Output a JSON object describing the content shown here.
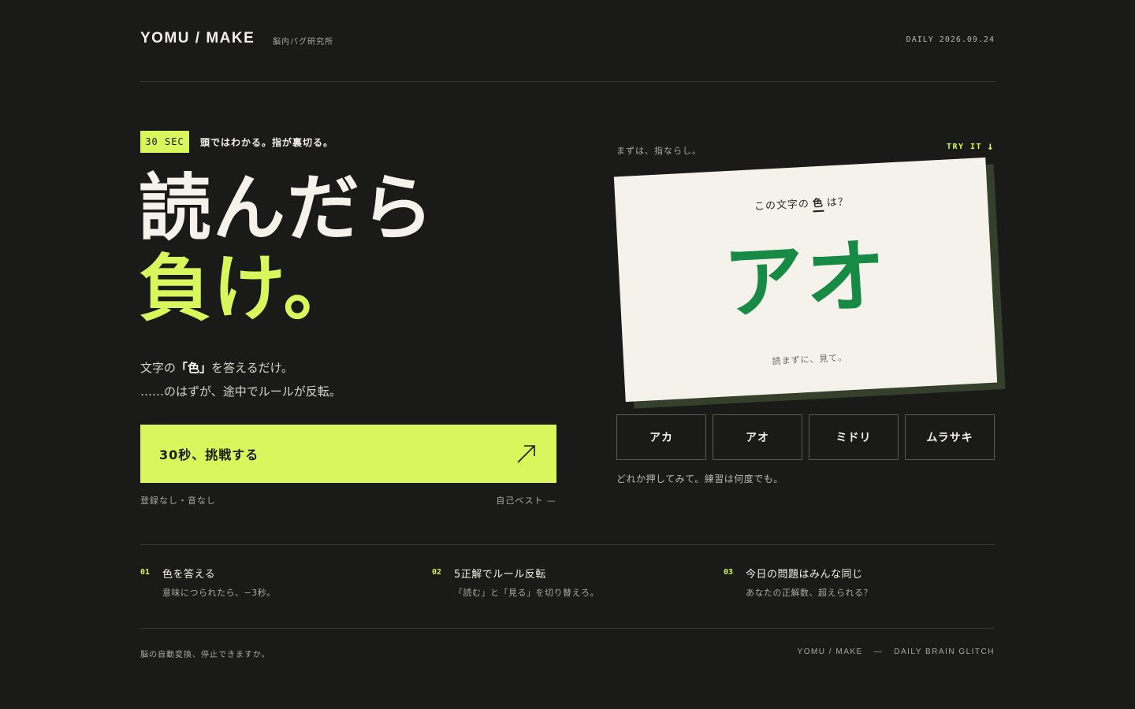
{
  "header": {
    "brand": "YOMU / MAKE",
    "brand_sub": "脳内バグ研究所",
    "daily": "DAILY 2026.09.24"
  },
  "hero": {
    "badge": "30 SEC",
    "tagline": "頭ではわかる。指が裏切る。",
    "headline_line1": "読んだら",
    "headline_line2": "負け。",
    "desc_part1": "文字の",
    "desc_bold": "「色」",
    "desc_part2": "を答えるだけ。",
    "desc_line2": "……のはずが、途中でルールが反転。",
    "cta_label": "30秒、挑戦する",
    "sub_left": "登録なし・音なし",
    "sub_right": "自己ベスト —"
  },
  "demo": {
    "hint": "まずは、指ならし。",
    "try_it": "TRY IT",
    "card": {
      "question_pre": "この文字の",
      "question_em": "色",
      "question_post": "は？",
      "word": "アオ",
      "word_color": "#178a45",
      "footer": "読まずに、見て。"
    },
    "answers": [
      "アカ",
      "アオ",
      "ミドリ",
      "ムラサキ"
    ],
    "note": "どれか押してみて。練習は何度でも。"
  },
  "steps": [
    {
      "num": "01",
      "title": "色を答える",
      "desc": "意味につられたら、−3秒。"
    },
    {
      "num": "02",
      "title": "5正解でルール反転",
      "desc": "「読む」と「見る」を切り替えろ。"
    },
    {
      "num": "03",
      "title": "今日の問題はみんな同じ",
      "desc": "あなたの正解数、超えられる？"
    }
  ],
  "footer": {
    "left": "脳の自動変換、停止できますか。",
    "right_brand": "YOMU / MAKE",
    "right_sep": "—",
    "right_tag": "DAILY BRAIN GLITCH"
  },
  "colors": {
    "background": "#1a1b18",
    "accent": "#d9f75c",
    "card": "#f4f2ea"
  }
}
